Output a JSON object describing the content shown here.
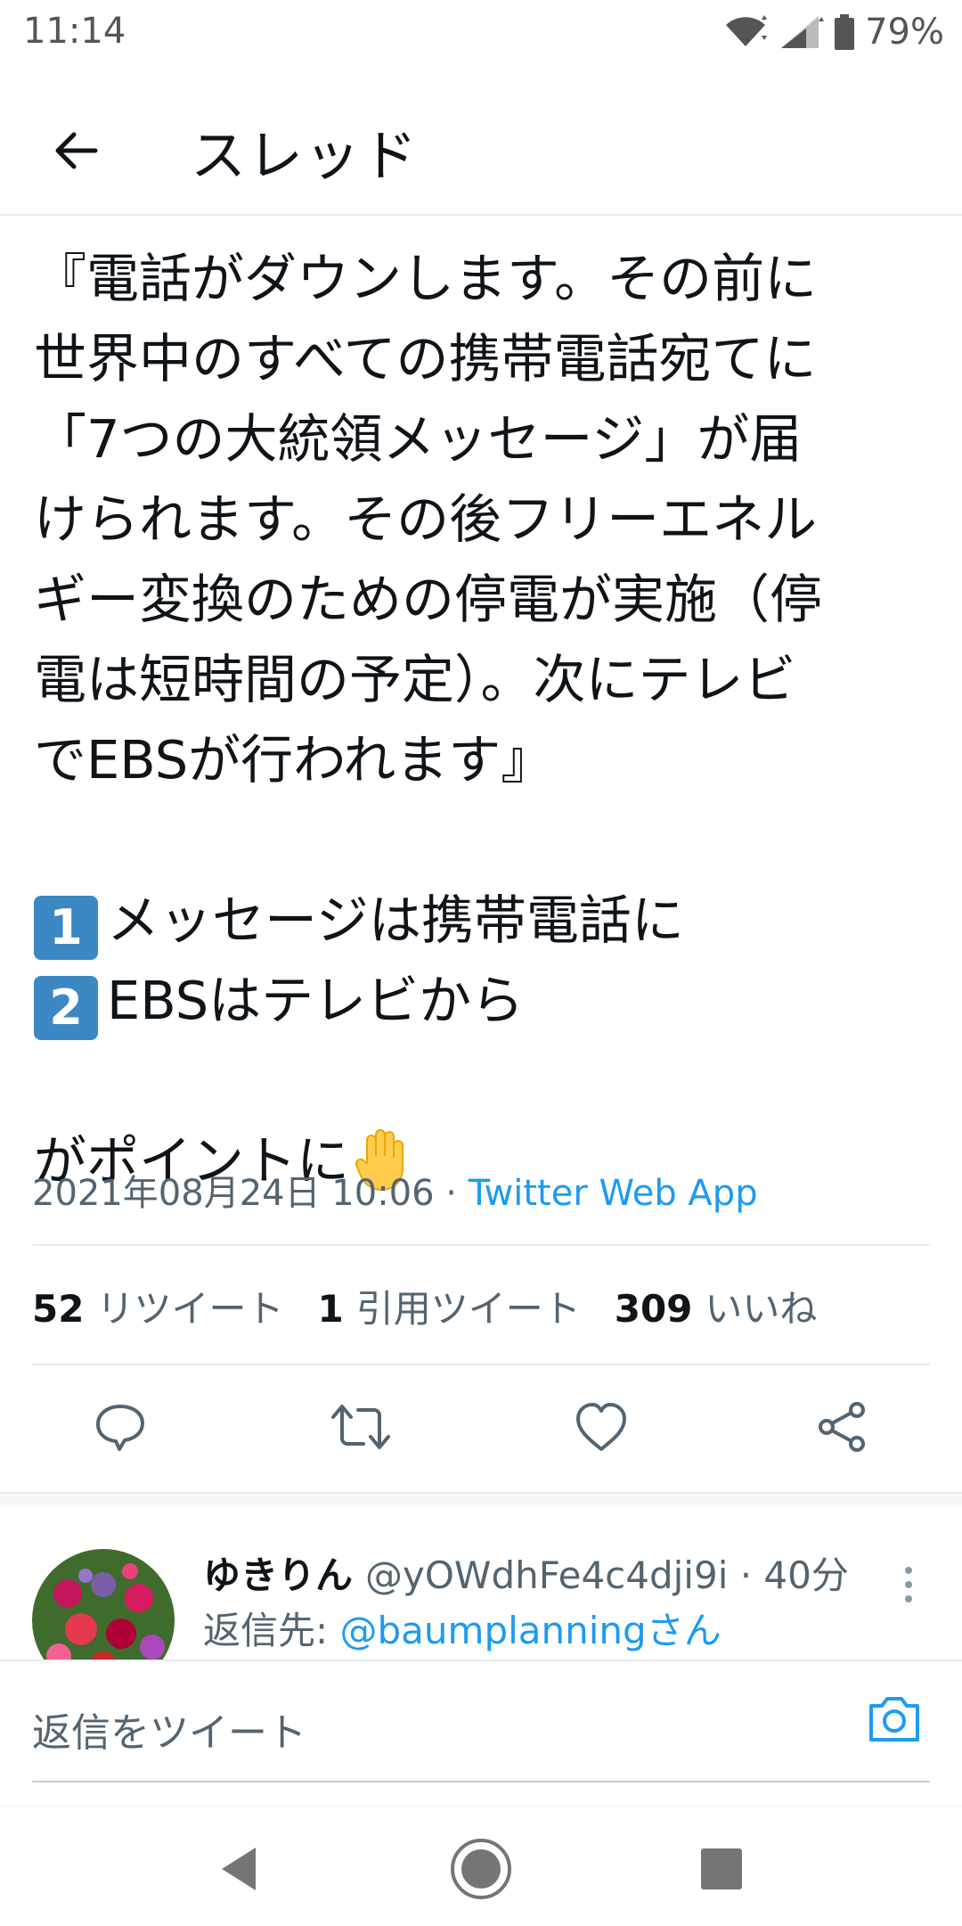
{
  "status_bar": {
    "time": "11:14",
    "battery": "79%"
  },
  "header": {
    "title": "スレッド"
  },
  "tweet": {
    "lines": [
      "『電話がダウンします。その前に",
      "世界中のすべての携帯電話宛てに",
      "「7つの大統領メッセージ」が届",
      "けられます。その後フリーエネル",
      "ギー変換のための停電が実施（停",
      "電は短時間の予定）。次にテレビ",
      "でEBSが行われます』"
    ],
    "point1": {
      "num": "1",
      "text": "メッセージは携帯電話に"
    },
    "point2": {
      "num": "2",
      "text": "EBSはテレビから"
    },
    "closing": "がポイントに",
    "timestamp": "2021年08月24日 10:06 · ",
    "source": "Twitter Web App"
  },
  "stats": {
    "retweets_count": "52",
    "retweets_label": "リツイート",
    "quotes_count": "1",
    "quotes_label": "引用ツイート",
    "likes_count": "309",
    "likes_label": "いいね"
  },
  "reply": {
    "name": "ゆきりん",
    "handle": "@yOWdhFe4c4dji9i · 40分",
    "reply_to_prefix": "返信先: ",
    "reply_to_user": "@baumplanningさん"
  },
  "compose": {
    "placeholder": "返信をツイート"
  },
  "icons": [
    "back-arrow-icon",
    "reply-icon",
    "retweet-icon",
    "like-icon",
    "share-icon",
    "camera-icon",
    "more-icon",
    "wifi-icon",
    "signal-icon",
    "battery-icon",
    "raised-hand-emoji"
  ],
  "colors": {
    "accent": "#1d9bf0",
    "text": "#0f1419",
    "muted": "#536471"
  }
}
